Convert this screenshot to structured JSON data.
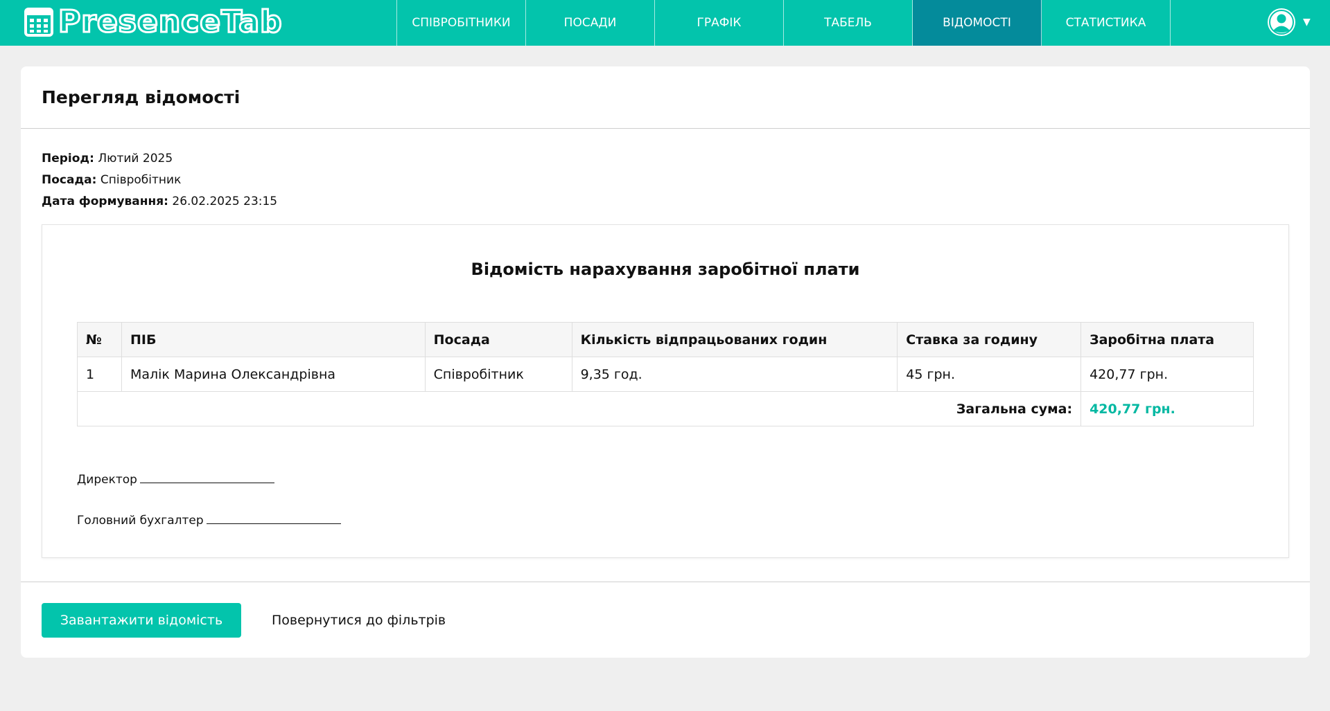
{
  "navbar": {
    "brand": "PresenceTab",
    "brand_icon": "calendar-grid-icon",
    "items": [
      {
        "label": "СПІВРОБІТНИКИ",
        "active": false
      },
      {
        "label": "ПОСАДИ",
        "active": false
      },
      {
        "label": "ГРАФІК",
        "active": false
      },
      {
        "label": "ТАБЕЛЬ",
        "active": false
      },
      {
        "label": "ВІДОМОСТІ",
        "active": true
      },
      {
        "label": "СТАТИСТИКА",
        "active": false
      }
    ],
    "user_icon": "user-avatar-icon",
    "user_caret": "▼"
  },
  "card": {
    "title": "Перегляд відомості",
    "meta": {
      "period_label": "Період:",
      "period_value": "Лютий 2025",
      "position_label": "Посада:",
      "position_value": "Співробітник",
      "created_label": "Дата формування:",
      "created_value": "26.02.2025 23:15"
    },
    "document": {
      "title": "Відомість нарахування заробітної плати",
      "columns": [
        "№",
        "ПІБ",
        "Посада",
        "Кількість відпрацьованих годин",
        "Ставка за годину",
        "Заробітна плата"
      ],
      "rows": [
        [
          "1",
          "Малік Марина Олександрівна",
          "Співробітник",
          "9,35 год.",
          "45 грн.",
          "420,77 грн."
        ]
      ],
      "total_label": "Загальна сума:",
      "total_value": "420,77 грн.",
      "signatures": {
        "director": "Директор",
        "accountant": "Головний бухгалтер"
      }
    },
    "footer": {
      "download_label": "Завантажити відомість",
      "back_label": "Повернутися до фільтрів"
    }
  },
  "colors": {
    "primary": "#03c4ac",
    "nav_active": "#048b9b",
    "total_text": "#03b8a2",
    "page_bg": "#efefef"
  }
}
